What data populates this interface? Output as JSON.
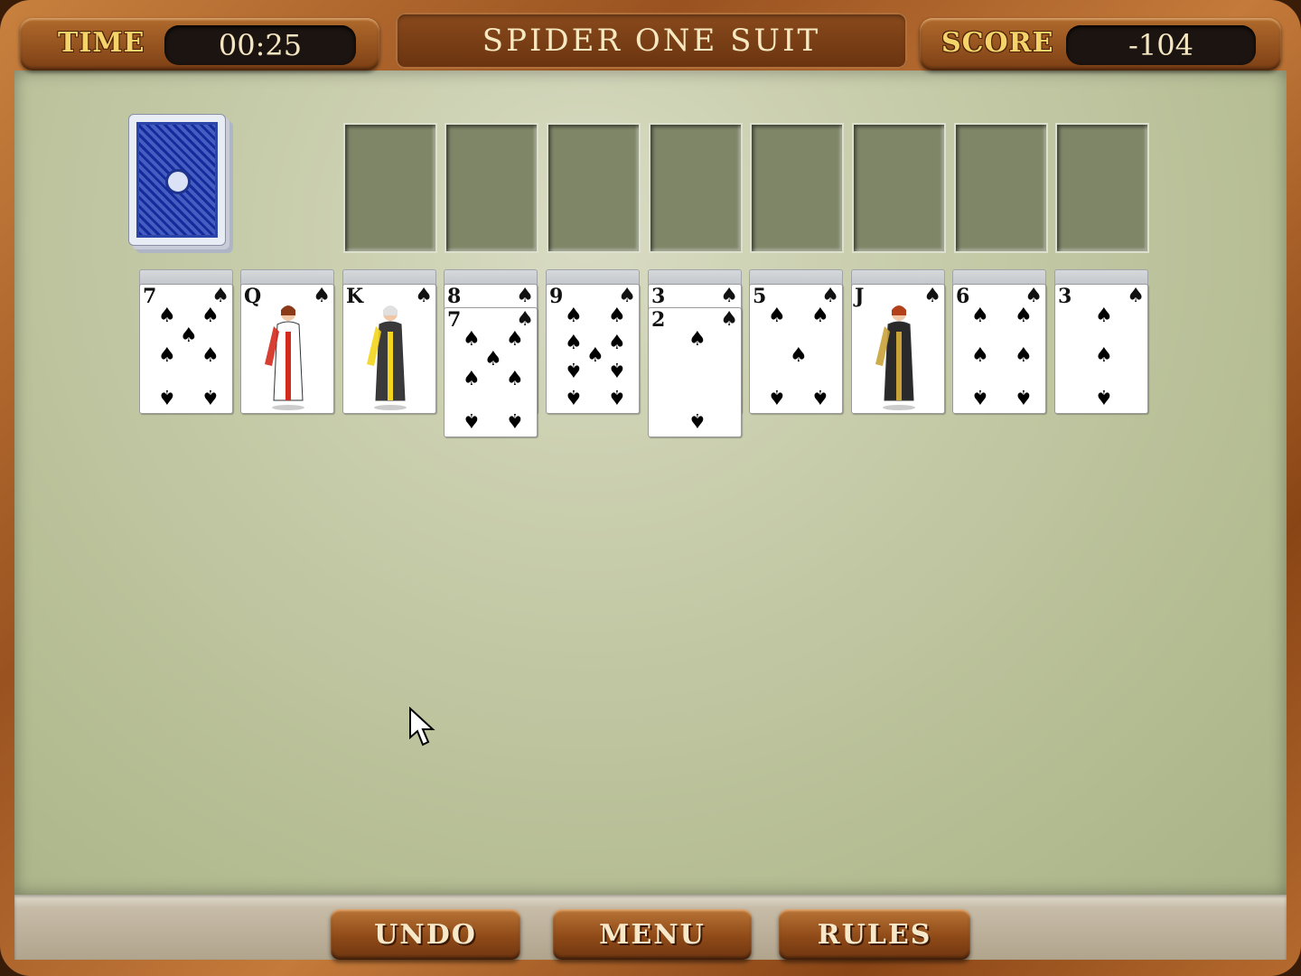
{
  "header": {
    "time_label": "TIME",
    "time_value": "00:25",
    "title": "SPIDER ONE SUIT",
    "score_label": "SCORE",
    "score_value": "-104"
  },
  "buttons": {
    "undo": "UNDO",
    "menu": "MENU",
    "rules": "RULES"
  },
  "stock": {
    "icon": "card-back-icon"
  },
  "foundations": {
    "count": 8
  },
  "suit_symbol": "♠",
  "tableau": [
    {
      "face_down": 1,
      "cards": [
        {
          "rank": "7"
        }
      ]
    },
    {
      "face_down": 1,
      "cards": [
        {
          "rank": "Q"
        }
      ]
    },
    {
      "face_down": 1,
      "cards": [
        {
          "rank": "K"
        }
      ]
    },
    {
      "face_down": 1,
      "cards": [
        {
          "rank": "8"
        },
        {
          "rank": "7"
        }
      ]
    },
    {
      "face_down": 1,
      "cards": [
        {
          "rank": "9"
        }
      ]
    },
    {
      "face_down": 1,
      "cards": [
        {
          "rank": "3"
        },
        {
          "rank": "2"
        }
      ]
    },
    {
      "face_down": 1,
      "cards": [
        {
          "rank": "5"
        }
      ]
    },
    {
      "face_down": 1,
      "cards": [
        {
          "rank": "J"
        }
      ]
    },
    {
      "face_down": 1,
      "cards": [
        {
          "rank": "6"
        }
      ]
    },
    {
      "face_down": 1,
      "cards": [
        {
          "rank": "3"
        }
      ]
    }
  ],
  "colors": {
    "felt": "#c6cba9",
    "frame": "#9a5220",
    "label_gold": "#f4d36a"
  }
}
